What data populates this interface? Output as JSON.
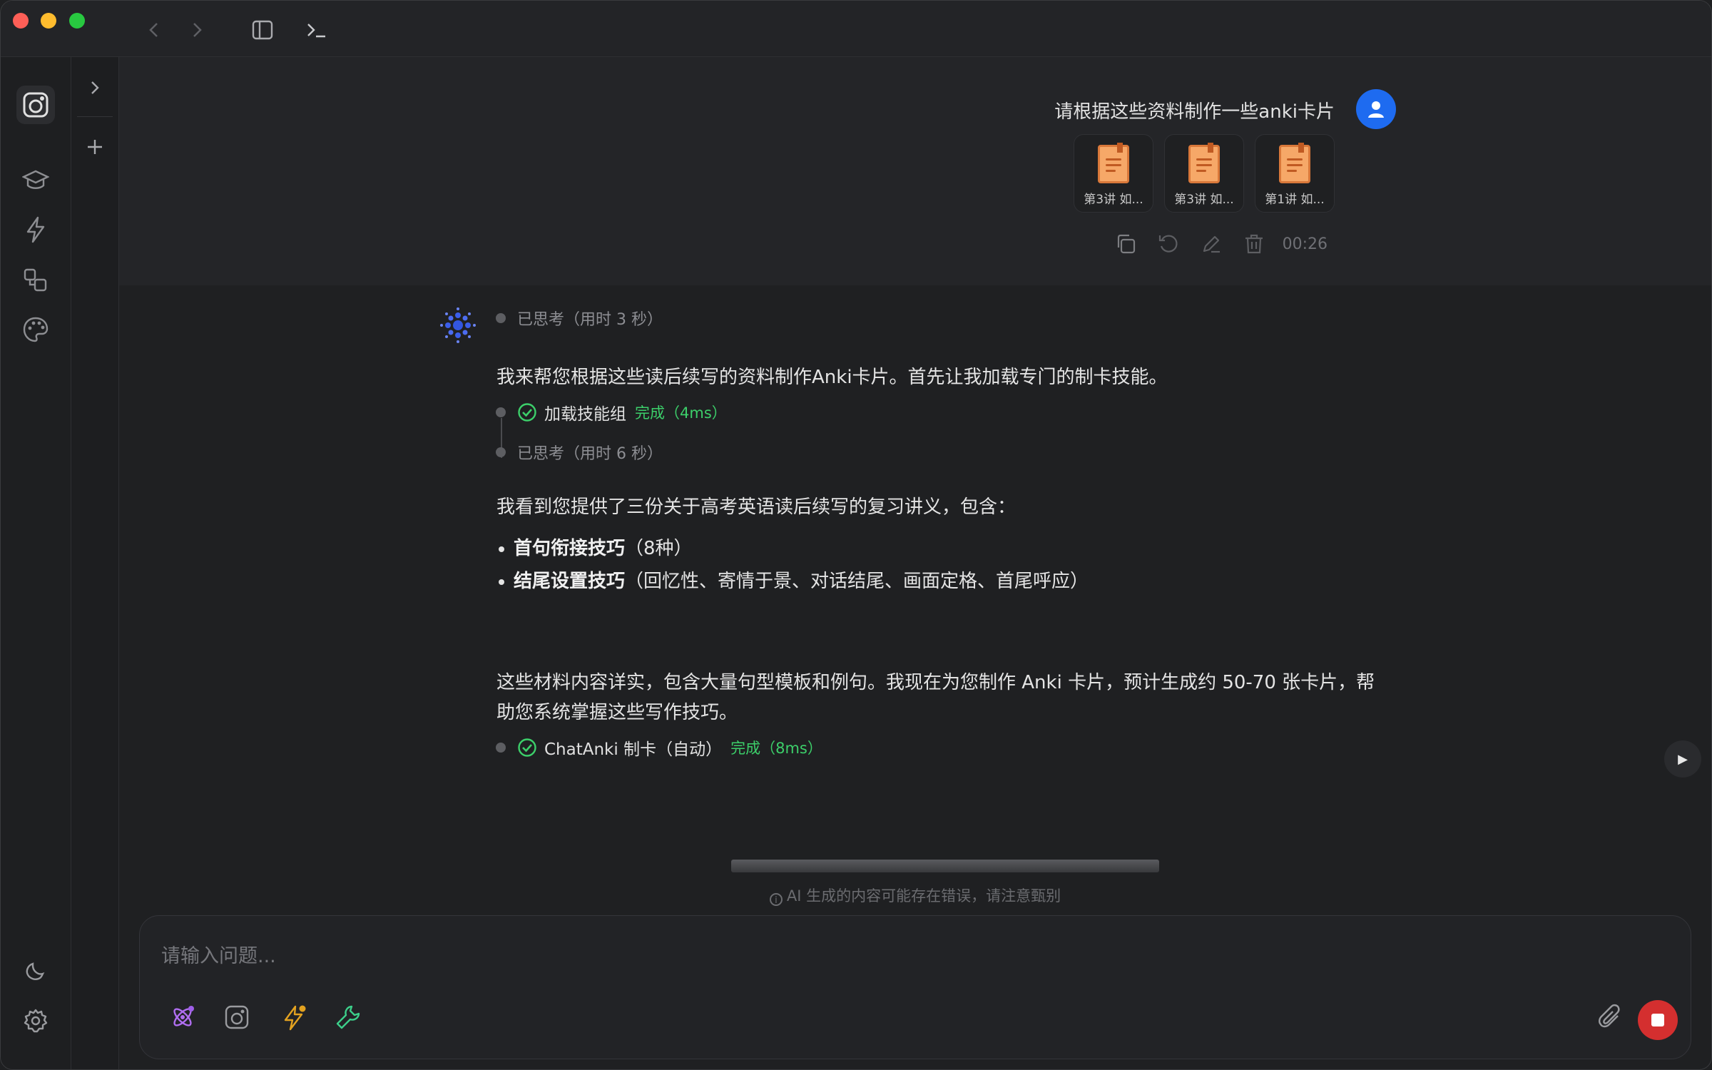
{
  "window": {
    "lights": [
      "#fe5f57",
      "#febc2e",
      "#28c840"
    ]
  },
  "titlebar": {
    "icons": [
      "chevron-left-icon",
      "chevron-right-icon",
      "sidebar-toggle-icon",
      "terminal-icon"
    ]
  },
  "rail": {
    "items": [
      "app-logo-icon",
      "graduation-cap-icon",
      "lightning-icon",
      "copy-shapes-icon",
      "palette-icon"
    ],
    "bottom": [
      "moon-icon",
      "gear-icon"
    ]
  },
  "user_message": {
    "text": "请根据这些资料制作一些anki卡片",
    "attachments": [
      {
        "name": "第3讲 如..."
      },
      {
        "name": "第3讲 如..."
      },
      {
        "name": "第1讲 如..."
      }
    ],
    "elapsed": "00:26"
  },
  "assistant": {
    "think1": "已思考（用时 3 秒）",
    "para1": "我来帮您根据这些读后续写的资料制作Anki卡片。首先让我加载专门的制卡技能。",
    "tool1": {
      "name": "加载技能组",
      "status": "完成（4ms）"
    },
    "think2": "已思考（用时 6 秒）",
    "para2": "我看到您提供了三份关于高考英语读后续写的复习讲义，包含：",
    "bullets": [
      {
        "bold": "首句衔接技巧",
        "rest": "（8种）"
      },
      {
        "bold": "结尾设置技巧",
        "rest": "（回忆性、寄情于景、对话结尾、画面定格、首尾呼应）"
      }
    ],
    "para3_line1": "这些材料内容详实，包含大量句型模板和例句。我现在为您制作 Anki 卡片，预计生成约 50-70 张卡片，帮",
    "para3_line2": "助您系统掌握这些写作技巧。",
    "tool2": {
      "name": "ChatAnki 制卡（自动）",
      "status": "完成（8ms）"
    }
  },
  "disclaimer": "AI 生成的内容可能存在错误，请注意甄别",
  "composer": {
    "placeholder": "请输入问题...",
    "tools": [
      "atom-icon",
      "anki-icon",
      "lightning-icon",
      "wrench-icon"
    ]
  },
  "colors": {
    "accent_blue": "#1e6bf0",
    "success_green": "#3ccf6a",
    "stop_red": "#d42f2f"
  }
}
